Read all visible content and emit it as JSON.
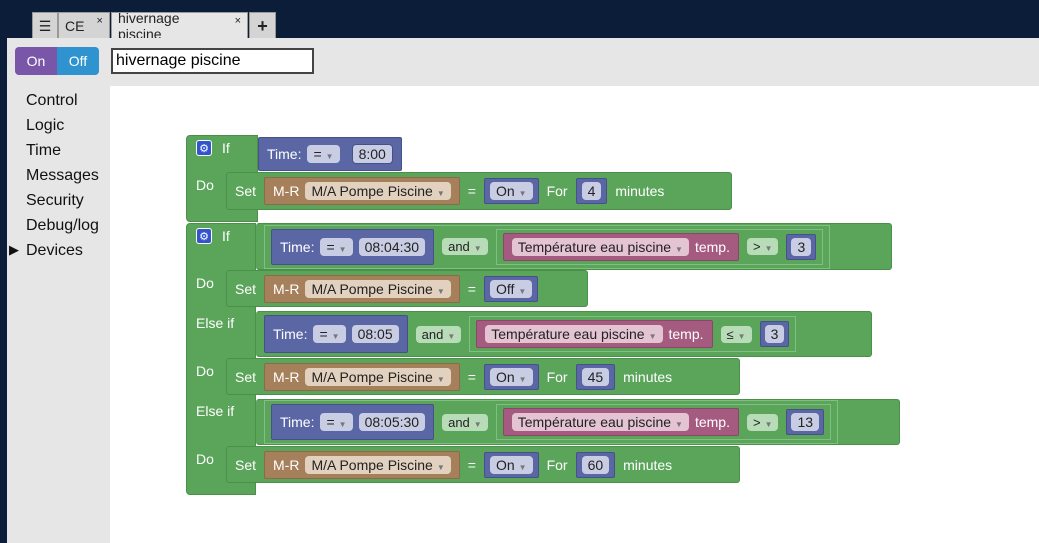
{
  "tabs": [
    {
      "label": "CE",
      "close": "×"
    },
    {
      "label": "hivernage piscine",
      "close": "×"
    }
  ],
  "menu_icon": "☰",
  "add_tab": "+",
  "toggle": {
    "on": "On",
    "off": "Off"
  },
  "script_name": "hivernage piscine",
  "categories": [
    "Control",
    "Logic",
    "Time",
    "Messages",
    "Security",
    "Debug/log",
    "Devices"
  ],
  "expanded_marker": "▶",
  "colors": {
    "logic": "#5ba55b",
    "time": "#5b67a5",
    "device": "#a5805b",
    "sensor": "#a55b80"
  },
  "w": {
    "if": "If",
    "do": "Do",
    "elseif": "Else if",
    "set": "Set",
    "for": "For",
    "minutes": "minutes",
    "time": "Time:",
    "eq": "=",
    "and": "and",
    "mr": "M-R",
    "pump": "M/A Pompe Piscine",
    "temp_dev": "Température eau piscine",
    "temp": "temp.",
    "on": "On",
    "off": "Off",
    "gt": ">",
    "le": "≤"
  },
  "b1": {
    "time": "8:00",
    "for": "4"
  },
  "b2": {
    "time1": "08:04:30",
    "val1": "3",
    "time2": "08:05",
    "val2": "3",
    "for2": "45",
    "time3": "08:05:30",
    "val3": "13",
    "for3": "60"
  }
}
